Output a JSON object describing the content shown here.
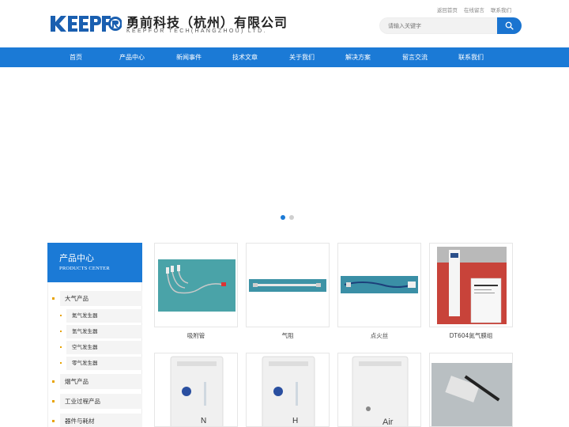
{
  "brand": {
    "logo_text": "KEEPFOR",
    "title": "勇前科技（杭州）有限公司",
    "subtitle": "KEEPFOR TECH(HANGZHOU) LTD."
  },
  "top_links": [
    "返回首页",
    "在线留言",
    "联系我们"
  ],
  "search": {
    "placeholder": "请输入关键字"
  },
  "nav": [
    "首页",
    "产品中心",
    "新闻事件",
    "技术文章",
    "关于我们",
    "解决方案",
    "留言交流",
    "联系我们"
  ],
  "banner": {
    "dots": 2,
    "active_dot": 0
  },
  "sidebar": {
    "title": "产品中心",
    "subtitle": "PRODUCTS CENTER",
    "categories": [
      {
        "label": "大气产品",
        "children": [
          "氮气发生器",
          "氢气发生器",
          "空气发生器",
          "零气发生器"
        ]
      },
      {
        "label": "烟气产品",
        "children": []
      },
      {
        "label": "工业过程产品",
        "children": []
      },
      {
        "label": "器件与耗材",
        "children": []
      }
    ]
  },
  "products": [
    {
      "name": "吸附管",
      "image": "tube-assembly"
    },
    {
      "name": "气阻",
      "image": "gas-restrictor"
    },
    {
      "name": "点火丝",
      "image": "ignition-wire"
    },
    {
      "name": "DT604氮气膜组",
      "image": "membrane-module"
    },
    {
      "name": "",
      "image": "nitrogen-generator"
    },
    {
      "name": "",
      "image": "hydrogen-generator"
    },
    {
      "name": "",
      "image": "air-generator"
    },
    {
      "name": "",
      "image": "probe-box"
    }
  ],
  "colors": {
    "primary": "#1b7ad6",
    "bullet": "#e8a300",
    "nav_text": "#ffffff"
  }
}
